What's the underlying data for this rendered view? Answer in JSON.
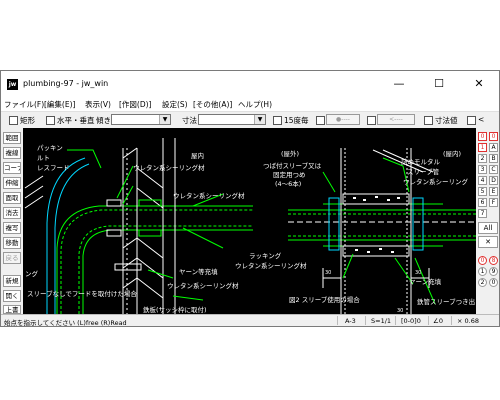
{
  "window": {
    "title": "plumbing-97 - jw_win",
    "app_icon": "jw",
    "minimize": "—",
    "maximize": "☐",
    "close": "✕"
  },
  "menu": [
    "ファイル(F)",
    "[編集(E)]",
    "表示(V)",
    "[作図(D)]",
    "設定(S)",
    "[その他(A)]",
    "ヘルプ(H)"
  ],
  "toolbar": {
    "rect_label": "矩形",
    "hv_label": "水平・垂直",
    "tilt_label": "傾き",
    "dim_label": "寸法",
    "deg15_label": "15度毎",
    "btn1": "●----",
    "btn2": "<----",
    "dimval_label": "寸法値",
    "last_label": "<"
  },
  "left_tools": [
    "範囲",
    "複線",
    "コーナー",
    "伸縮",
    "面取",
    "消去",
    "複写",
    "移動",
    "戻る",
    "新規",
    "開く",
    "上書"
  ],
  "right_tools": {
    "col1": [
      "0",
      "1",
      "2",
      "3",
      "4",
      "5",
      "6",
      "7"
    ],
    "col2": [
      "0",
      "A",
      "B",
      "C",
      "D",
      "E",
      "F"
    ],
    "all": "All",
    "x": "✕",
    "circ1": [
      "0",
      "1",
      "2"
    ],
    "circ2": [
      "8",
      "9",
      "0"
    ]
  },
  "drawing": {
    "left_labels": [
      "パッキン",
      "ルト",
      "レスフード",
      "屋内",
      "ウレタン系シーリング材",
      "ウレタン系シーリング材",
      "ヤーン等充填",
      "ウレタン系シーリング材",
      "スリーブなしでフードを取付けた場合",
      "ング",
      "鉄板(サッシ枠に取付)"
    ],
    "right_labels": [
      "(屋外)",
      "つば付スリーブ又は",
      "固定用つめ",
      "(4〜6本)",
      "(屋内)",
      "詰めモルタル",
      "スリーブ管",
      "ウレタン系シーリング",
      "ラッキング",
      "ウレタン系シーリング材",
      "ヤーン充填",
      "鉄管スリーブつき出",
      "図2 スリーブ使用の場合",
      "30",
      "30",
      "30"
    ]
  },
  "status": {
    "prompt": "始点を指示してください (L)free (R)Read",
    "paper": "A-3",
    "scale": "S=1/1",
    "layer": "[0-0]0",
    "angle": "∠0",
    "zoom": "× 0.68"
  },
  "colors": {
    "canvas": "#000000",
    "line_white": "#ffffff",
    "line_green": "#00ff00",
    "line_cyan": "#00d8ff",
    "accent_red": "#e03030"
  }
}
